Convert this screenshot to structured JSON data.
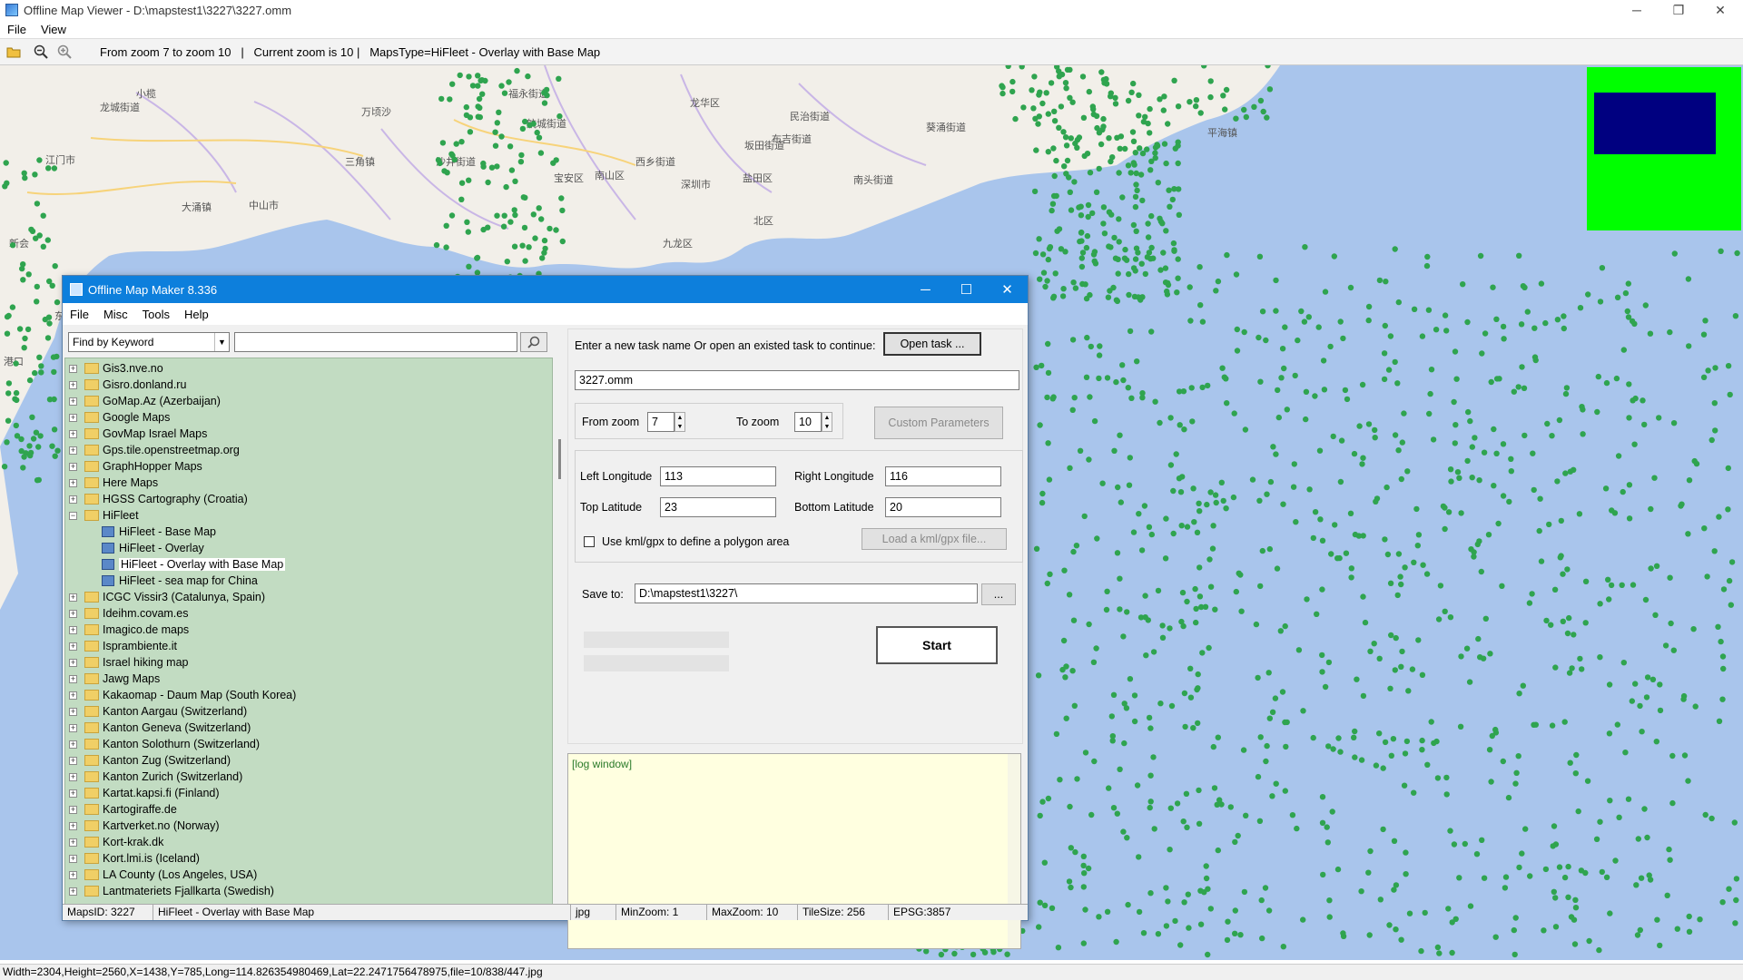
{
  "outer": {
    "title": "Offline Map Viewer - D:\\mapstest1\\3227\\3227.omm",
    "menu": [
      "File",
      "View"
    ],
    "toolbar_info": "From zoom 7 to zoom 10   |   Current zoom is 10 |   MapsType=HiFleet - Overlay with Base Map",
    "status": "Width=2304,Height=2560,X=1438,Y=785,Long=114.826354980469,Lat=22.2471756478975,file=10/838/447.jpg"
  },
  "map_labels": [
    "江门市",
    "新会",
    "中山市",
    "小榄",
    "万顷沙",
    "福永街道",
    "航城街道",
    "龙华区",
    "民治街道",
    "布吉街道",
    "南山区",
    "深圳市",
    "盐田区",
    "坂田街道",
    "葵涌街道",
    "平海镇",
    "北区",
    "宝安区",
    "大涌镇",
    "三角镇",
    "龙城街道",
    "沙井街道",
    "西乡街道",
    "南头街道",
    "东华",
    "港口",
    "九龙区"
  ],
  "win": {
    "title": "Offline Map Maker 8.336",
    "menu": [
      "File",
      "Misc",
      "Tools",
      "Help"
    ],
    "find_select": "Find by Keyword",
    "find_value": "",
    "tree": [
      {
        "label": "Gis3.nve.no",
        "type": "folder",
        "expanded": false
      },
      {
        "label": "Gisro.donland.ru",
        "type": "folder",
        "expanded": false
      },
      {
        "label": "GoMap.Az (Azerbaijan)",
        "type": "folder",
        "expanded": false
      },
      {
        "label": "Google Maps",
        "type": "folder",
        "expanded": false
      },
      {
        "label": "GovMap Israel Maps",
        "type": "folder",
        "expanded": false
      },
      {
        "label": "Gps.tile.openstreetmap.org",
        "type": "folder",
        "expanded": false
      },
      {
        "label": "GraphHopper Maps",
        "type": "folder",
        "expanded": false
      },
      {
        "label": "Here Maps",
        "type": "folder",
        "expanded": false
      },
      {
        "label": "HGSS Cartography (Croatia)",
        "type": "folder",
        "expanded": false
      },
      {
        "label": "HiFleet",
        "type": "folder",
        "expanded": true
      },
      {
        "label": "HiFleet - Base Map",
        "type": "map",
        "selected": false
      },
      {
        "label": "HiFleet - Overlay",
        "type": "map",
        "selected": false
      },
      {
        "label": "HiFleet - Overlay with Base Map",
        "type": "map",
        "selected": true
      },
      {
        "label": "HiFleet - sea map for China",
        "type": "map",
        "selected": false
      },
      {
        "label": "ICGC Vissir3 (Catalunya, Spain)",
        "type": "folder",
        "expanded": false
      },
      {
        "label": "Ideihm.covam.es",
        "type": "folder",
        "expanded": false
      },
      {
        "label": "Imagico.de maps",
        "type": "folder",
        "expanded": false
      },
      {
        "label": "Isprambiente.it",
        "type": "folder",
        "expanded": false
      },
      {
        "label": "Israel hiking map",
        "type": "folder",
        "expanded": false
      },
      {
        "label": "Jawg Maps",
        "type": "folder",
        "expanded": false
      },
      {
        "label": "Kakaomap - Daum Map (South Korea)",
        "type": "folder",
        "expanded": false
      },
      {
        "label": "Kanton Aargau (Switzerland)",
        "type": "folder",
        "expanded": false
      },
      {
        "label": "Kanton Geneva (Switzerland)",
        "type": "folder",
        "expanded": false
      },
      {
        "label": "Kanton Solothurn (Switzerland)",
        "type": "folder",
        "expanded": false
      },
      {
        "label": "Kanton Zug (Switzerland)",
        "type": "folder",
        "expanded": false
      },
      {
        "label": "Kanton Zurich (Switzerland)",
        "type": "folder",
        "expanded": false
      },
      {
        "label": "Kartat.kapsi.fi (Finland)",
        "type": "folder",
        "expanded": false
      },
      {
        "label": "Kartogiraffe.de",
        "type": "folder",
        "expanded": false
      },
      {
        "label": "Kartverket.no (Norway)",
        "type": "folder",
        "expanded": false
      },
      {
        "label": "Kort-krak.dk",
        "type": "folder",
        "expanded": false
      },
      {
        "label": "Kort.lmi.is (Iceland)",
        "type": "folder",
        "expanded": false
      },
      {
        "label": "LA County (Los Angeles, USA)",
        "type": "folder",
        "expanded": false
      },
      {
        "label": "Lantmateriets Fjallkarta (Swedish)",
        "type": "folder",
        "expanded": false
      }
    ],
    "task_prompt": "Enter a new task name Or open an existed task to continue:",
    "open_task": "Open task ...",
    "task_name": "3227.omm",
    "from_zoom_label": "From zoom",
    "from_zoom": "7",
    "to_zoom_label": "To zoom",
    "to_zoom": "10",
    "custom_params": "Custom Parameters",
    "left_lon_label": "Left Longitude",
    "left_lon": "113",
    "right_lon_label": "Right Longitude",
    "right_lon": "116",
    "top_lat_label": "Top Latitude",
    "top_lat": "23",
    "bottom_lat_label": "Bottom Latitude",
    "bottom_lat": "20",
    "kml_label": "Use kml/gpx to define a polygon area",
    "kml_btn": "Load a kml/gpx file...",
    "save_label": "Save to:",
    "save_path": "D:\\mapstest1\\3227\\",
    "browse": "...",
    "start": "Start",
    "log": "[log window]",
    "status": {
      "maps_id": "MapsID: 3227",
      "map_name": "HiFleet - Overlay with Base Map",
      "format": "jpg",
      "min_zoom": "MinZoom: 1",
      "max_zoom": "MaxZoom: 10",
      "tile_size": "TileSize: 256",
      "epsg": "EPSG:3857"
    }
  },
  "colors": {
    "land": "#f2efe9",
    "sea": "#a9c5ec",
    "dots": "#2fa44f",
    "title_bar": "#0d7fdc",
    "tree_bg": "#c2dcc2",
    "minimap_frame": "#00ff00",
    "minimap_view": "#000080"
  }
}
